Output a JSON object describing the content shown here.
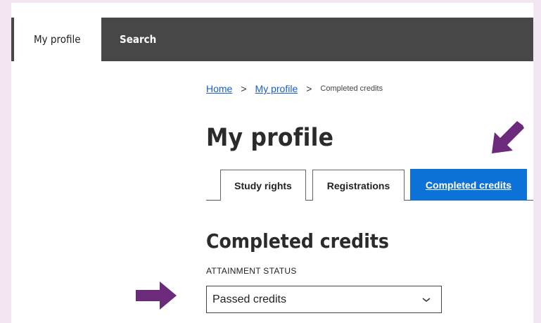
{
  "nav": {
    "tabs": [
      {
        "label": "My profile"
      },
      {
        "label": "Search"
      }
    ]
  },
  "breadcrumb": {
    "home": "Home",
    "separator": ">",
    "my_profile": "My profile",
    "current": "Completed credits"
  },
  "page_title": "My profile",
  "tabs": [
    {
      "label": "Study rights"
    },
    {
      "label": "Registrations"
    },
    {
      "label": "Completed credits"
    }
  ],
  "section": {
    "title": "Completed credits",
    "field_label": "ATTAINMENT STATUS",
    "select_value": "Passed credits"
  },
  "colors": {
    "nav_bg": "#474747",
    "active_tab": "#0c72d8",
    "annotation_arrow": "#6b2a7b",
    "outer_bg": "#f1e6f1"
  },
  "icons": {
    "select": "chevron-down-icon",
    "annotation": "arrow-icon"
  }
}
